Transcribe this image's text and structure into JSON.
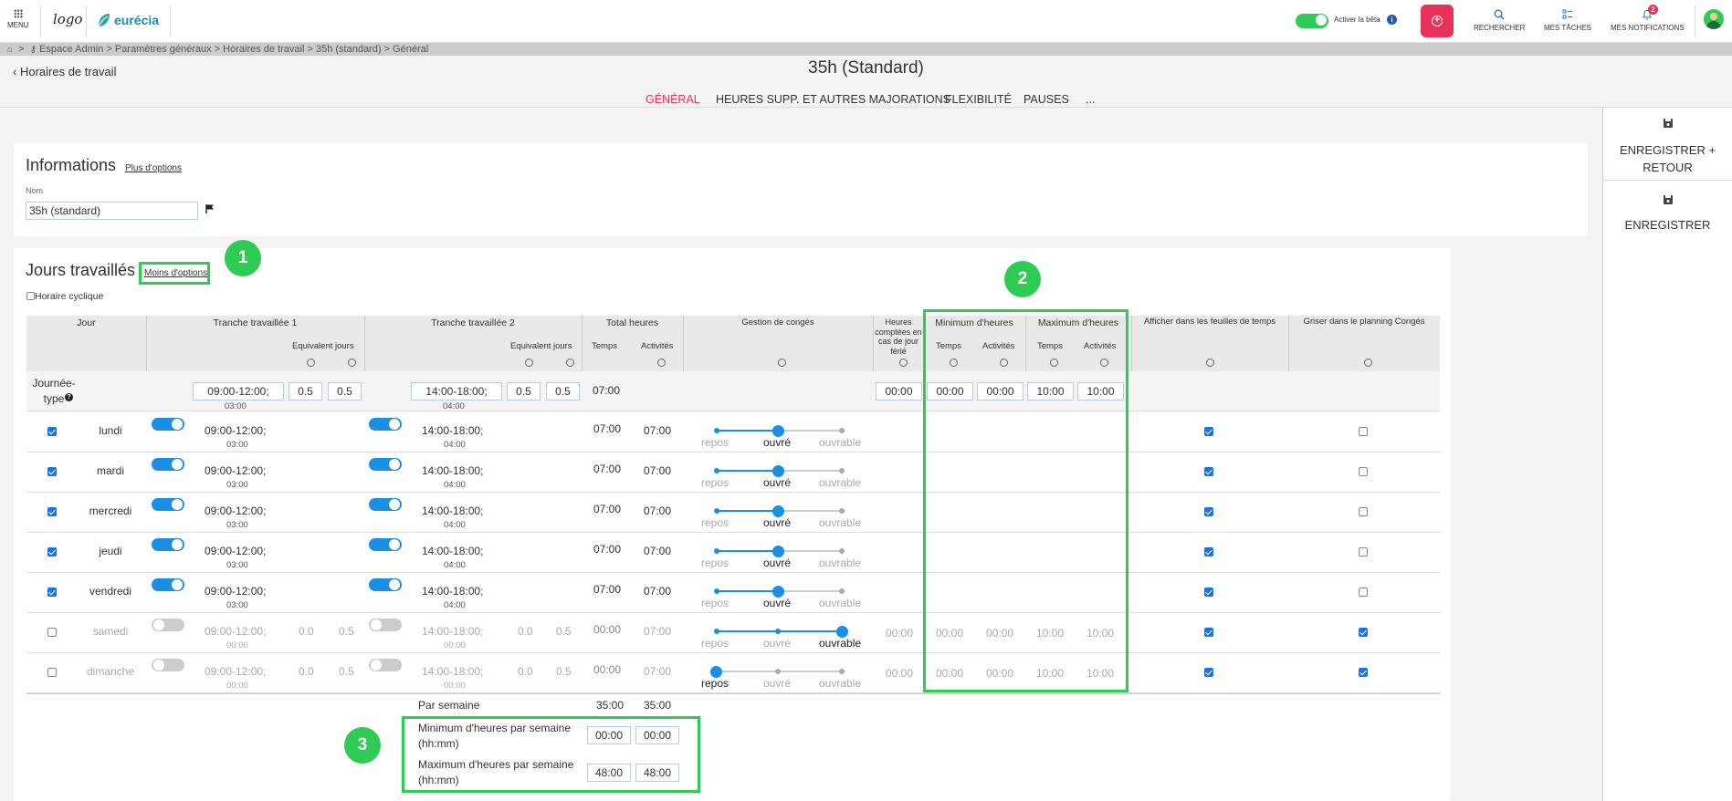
{
  "topbar": {
    "menu_label": "MENU",
    "logo_text": "logo",
    "brand_name": "eurécia",
    "beta_label": "Activer la bêta",
    "search_label": "RECHERCHER",
    "tasks_label": "MES TÂCHES",
    "notifications_label": "MES NOTIFICATIONS",
    "notifications_count": "2",
    "accent_color": "#e8325a"
  },
  "breadcrumb": {
    "text": "Espace Admin > Paramètres généraux > Horaires de travail > 35h (standard) > Général",
    "separator": ">"
  },
  "header": {
    "back_label": "Horaires de travail",
    "title": "35h (Standard)"
  },
  "tabs": [
    "GÉNÉRAL",
    "HEURES SUPP. ET AUTRES MAJORATIONS",
    "FLEXIBILITÉ",
    "PAUSES",
    "..."
  ],
  "side": {
    "save_return": "ENREGISTRER + RETOUR",
    "save": "ENREGISTRER"
  },
  "info": {
    "title": "Informations",
    "more_options": "Plus d'options",
    "name_label": "Nom",
    "name_value": "35h (standard)"
  },
  "worked": {
    "title": "Jours travaillés",
    "less_options": "Moins d'options",
    "cyclic_label": "Horaire cyclique"
  },
  "headers": {
    "jour": "Jour",
    "tranche1": "Tranche travaillée 1",
    "tranche2": "Tranche travaillée 2",
    "equiv": "Equivalent jours",
    "total": "Total heures",
    "temps": "Temps",
    "activites": "Activités",
    "conges": "Gestion de congés",
    "ferie": "Heures comptées en cas de jour férié",
    "min": "Minimum d'heures",
    "max": "Maximum d'heures",
    "feuilles": "Afficher dans les feuilles de temps",
    "griser": "Griser dans le planning Congés"
  },
  "typical": {
    "label": "Journée-type",
    "t1": "09:00-12:00;",
    "t1_sub": "03:00",
    "e1a": "0.5",
    "e1b": "0.5",
    "t2": "14:00-18:00;",
    "t2_sub": "04:00",
    "e2a": "0.5",
    "e2b": "0.5",
    "total": "07:00",
    "ferie": "00:00",
    "min_t": "00:00",
    "min_a": "00:00",
    "max_t": "10:00",
    "max_a": "10:00"
  },
  "slider_labels": [
    "repos",
    "ouvré",
    "ouvrable"
  ],
  "days": [
    {
      "name": "lundi",
      "checked": true,
      "t1": "09:00-12:00;",
      "t1_sub": "03:00",
      "t2": "14:00-18:00;",
      "t2_sub": "04:00",
      "e1a": "",
      "e1b": "",
      "e2a": "",
      "e2b": "",
      "tot_t": "07:00",
      "tot_a": "07:00",
      "level": "ouvré",
      "ferie": "",
      "min_t": "",
      "min_a": "",
      "max_t": "",
      "max_a": "",
      "feuilles": true,
      "griser": false,
      "active": true
    },
    {
      "name": "mardi",
      "checked": true,
      "t1": "09:00-12:00;",
      "t1_sub": "03:00",
      "t2": "14:00-18:00;",
      "t2_sub": "04:00",
      "e1a": "",
      "e1b": "",
      "e2a": "",
      "e2b": "",
      "tot_t": "07:00",
      "tot_a": "07:00",
      "level": "ouvré",
      "ferie": "",
      "min_t": "",
      "min_a": "",
      "max_t": "",
      "max_a": "",
      "feuilles": true,
      "griser": false,
      "active": true
    },
    {
      "name": "mercredi",
      "checked": true,
      "t1": "09:00-12:00;",
      "t1_sub": "03:00",
      "t2": "14:00-18:00;",
      "t2_sub": "04:00",
      "e1a": "",
      "e1b": "",
      "e2a": "",
      "e2b": "",
      "tot_t": "07:00",
      "tot_a": "07:00",
      "level": "ouvré",
      "ferie": "",
      "min_t": "",
      "min_a": "",
      "max_t": "",
      "max_a": "",
      "feuilles": true,
      "griser": false,
      "active": true
    },
    {
      "name": "jeudi",
      "checked": true,
      "t1": "09:00-12:00;",
      "t1_sub": "03:00",
      "t2": "14:00-18:00;",
      "t2_sub": "04:00",
      "e1a": "",
      "e1b": "",
      "e2a": "",
      "e2b": "",
      "tot_t": "07:00",
      "tot_a": "07:00",
      "level": "ouvré",
      "ferie": "",
      "min_t": "",
      "min_a": "",
      "max_t": "",
      "max_a": "",
      "feuilles": true,
      "griser": false,
      "active": true
    },
    {
      "name": "vendredi",
      "checked": true,
      "t1": "09:00-12:00;",
      "t1_sub": "03:00",
      "t2": "14:00-18:00;",
      "t2_sub": "04:00",
      "e1a": "",
      "e1b": "",
      "e2a": "",
      "e2b": "",
      "tot_t": "07:00",
      "tot_a": "07:00",
      "level": "ouvré",
      "ferie": "",
      "min_t": "",
      "min_a": "",
      "max_t": "",
      "max_a": "",
      "feuilles": true,
      "griser": false,
      "active": true
    },
    {
      "name": "samedi",
      "checked": false,
      "t1": "09:00-12:00;",
      "t1_sub": "00:00",
      "t2": "14:00-18:00;",
      "t2_sub": "00:00",
      "e1a": "0.0",
      "e1b": "0.5",
      "e2a": "0.0",
      "e2b": "0.5",
      "tot_t": "00:00",
      "tot_a": "07:00",
      "level": "ouvrable",
      "ferie": "00:00",
      "min_t": "00:00",
      "min_a": "00:00",
      "max_t": "10:00",
      "max_a": "10:00",
      "feuilles": true,
      "griser": true,
      "active": false
    },
    {
      "name": "dimanche",
      "checked": false,
      "t1": "09:00-12:00;",
      "t1_sub": "00:00",
      "t2": "14:00-18:00;",
      "t2_sub": "00:00",
      "e1a": "0.0",
      "e1b": "0.5",
      "e2a": "0.0",
      "e2b": "0.5",
      "tot_t": "00:00",
      "tot_a": "07:00",
      "level": "repos",
      "ferie": "00:00",
      "min_t": "00:00",
      "min_a": "00:00",
      "max_t": "10:00",
      "max_a": "10:00",
      "feuilles": true,
      "griser": true,
      "active": false
    }
  ],
  "weekly": {
    "per_week": "Par semaine",
    "per_week_t": "35:00",
    "per_week_a": "35:00",
    "min_label": "Minimum d'heures par semaine (hh:mm)",
    "min_t": "00:00",
    "min_a": "00:00",
    "max_label": "Maximum d'heures par semaine (hh:mm)",
    "max_t": "48:00",
    "max_a": "48:00"
  },
  "annotations": [
    "1",
    "2",
    "3"
  ]
}
